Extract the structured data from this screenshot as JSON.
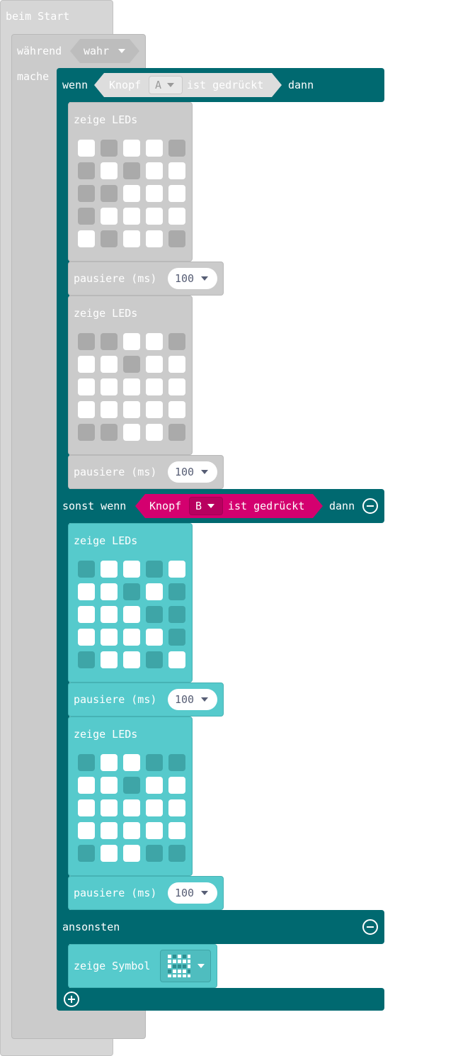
{
  "on_start": {
    "label": "beim Start"
  },
  "while_loop": {
    "label": "während",
    "condition": "wahr",
    "do_label": "mache"
  },
  "if_block": {
    "if_label": "wenn",
    "then_label": "dann",
    "condition": {
      "button_label": "Knopf",
      "button": "A",
      "pressed_label": "ist gedrückt"
    }
  },
  "elseif_block": {
    "label": "sonst wenn",
    "then_label": "dann",
    "condition": {
      "button_label": "Knopf",
      "button": "B",
      "pressed_label": "ist gedrückt"
    }
  },
  "else_block": {
    "label": "ansonsten"
  },
  "blocks": [
    {
      "label": "zeige LEDs",
      "style": "grey",
      "leds": [
        [
          0,
          1,
          0,
          0,
          1
        ],
        [
          1,
          0,
          1,
          0,
          0
        ],
        [
          1,
          1,
          0,
          0,
          0
        ],
        [
          1,
          0,
          0,
          0,
          0
        ],
        [
          0,
          1,
          0,
          0,
          1
        ]
      ]
    },
    {
      "label": "pausiere (ms)",
      "value": "100",
      "style": "grey"
    },
    {
      "label": "zeige LEDs",
      "style": "grey",
      "leds": [
        [
          1,
          1,
          0,
          0,
          1
        ],
        [
          0,
          0,
          1,
          0,
          0
        ],
        [
          0,
          0,
          0,
          0,
          0
        ],
        [
          0,
          0,
          0,
          0,
          0
        ],
        [
          1,
          1,
          0,
          0,
          1
        ]
      ]
    },
    {
      "label": "pausiere (ms)",
      "value": "100",
      "style": "grey"
    },
    {
      "label": "zeige LEDs",
      "style": "cyan",
      "leds": [
        [
          1,
          0,
          0,
          1,
          0
        ],
        [
          0,
          0,
          1,
          0,
          1
        ],
        [
          0,
          0,
          0,
          1,
          1
        ],
        [
          0,
          0,
          0,
          0,
          1
        ],
        [
          1,
          0,
          0,
          1,
          0
        ]
      ]
    },
    {
      "label": "pausiere (ms)",
      "value": "100",
      "style": "cyan"
    },
    {
      "label": "zeige LEDs",
      "style": "cyan",
      "leds": [
        [
          1,
          0,
          0,
          1,
          1
        ],
        [
          0,
          0,
          1,
          0,
          0
        ],
        [
          0,
          0,
          0,
          0,
          0
        ],
        [
          0,
          0,
          0,
          0,
          0
        ],
        [
          1,
          0,
          0,
          1,
          1
        ]
      ]
    },
    {
      "label": "pausiere (ms)",
      "value": "100",
      "style": "cyan"
    }
  ],
  "show_icon": {
    "label": "zeige Symbol"
  },
  "colors": {
    "grey_block": "#cbcbcb",
    "grey_led_on": "#aaaaaa",
    "logic_teal": "#006970",
    "input_cyan": "#56cacc",
    "cyan_led_on": "#3ea5a7",
    "button_magenta": "#d4006f",
    "led_off": "#ffffff"
  }
}
